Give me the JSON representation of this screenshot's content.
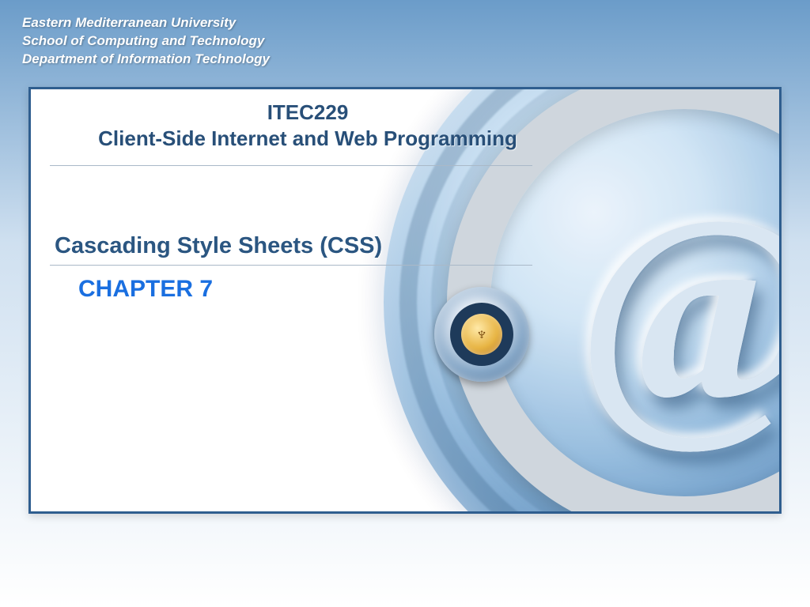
{
  "header": {
    "line1": "Eastern Mediterranean University",
    "line2": "School of Computing and Technology",
    "line3": "Department of Information Technology"
  },
  "course": {
    "code": "ITEC229",
    "name": "Client-Side Internet and Web Programming"
  },
  "topic": "Cascading Style Sheets (CSS)",
  "chapter": "CHAPTER 7",
  "decorative": {
    "at_symbol": "@",
    "seal_emblem": "♆"
  }
}
